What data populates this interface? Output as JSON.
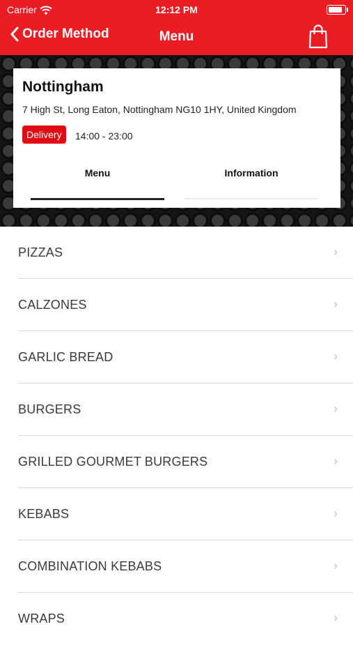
{
  "status_bar": {
    "carrier": "Carrier",
    "time": "12:12 PM",
    "battery_level": 0.85
  },
  "nav": {
    "back_label": "Order Method",
    "title": "Menu",
    "cart_icon": "shopping-bag-icon"
  },
  "store": {
    "name": "Nottingham",
    "address": "7 High St, Long Eaton, Nottingham NG10 1HY, United Kingdom",
    "badge": "Delivery",
    "hours": "14:00 - 23:00"
  },
  "tabs": [
    {
      "label": "Menu",
      "active": true
    },
    {
      "label": "Information",
      "active": false
    }
  ],
  "categories": [
    {
      "label": "PIZZAS"
    },
    {
      "label": "CALZONES"
    },
    {
      "label": "GARLIC BREAD"
    },
    {
      "label": "BURGERS"
    },
    {
      "label": "GRILLED GOURMET BURGERS"
    },
    {
      "label": "KEBABS"
    },
    {
      "label": "COMBINATION KEBABS"
    },
    {
      "label": "WRAPS"
    }
  ],
  "colors": {
    "brand_red": "#ec1c24",
    "badge_red": "#e20b15"
  }
}
